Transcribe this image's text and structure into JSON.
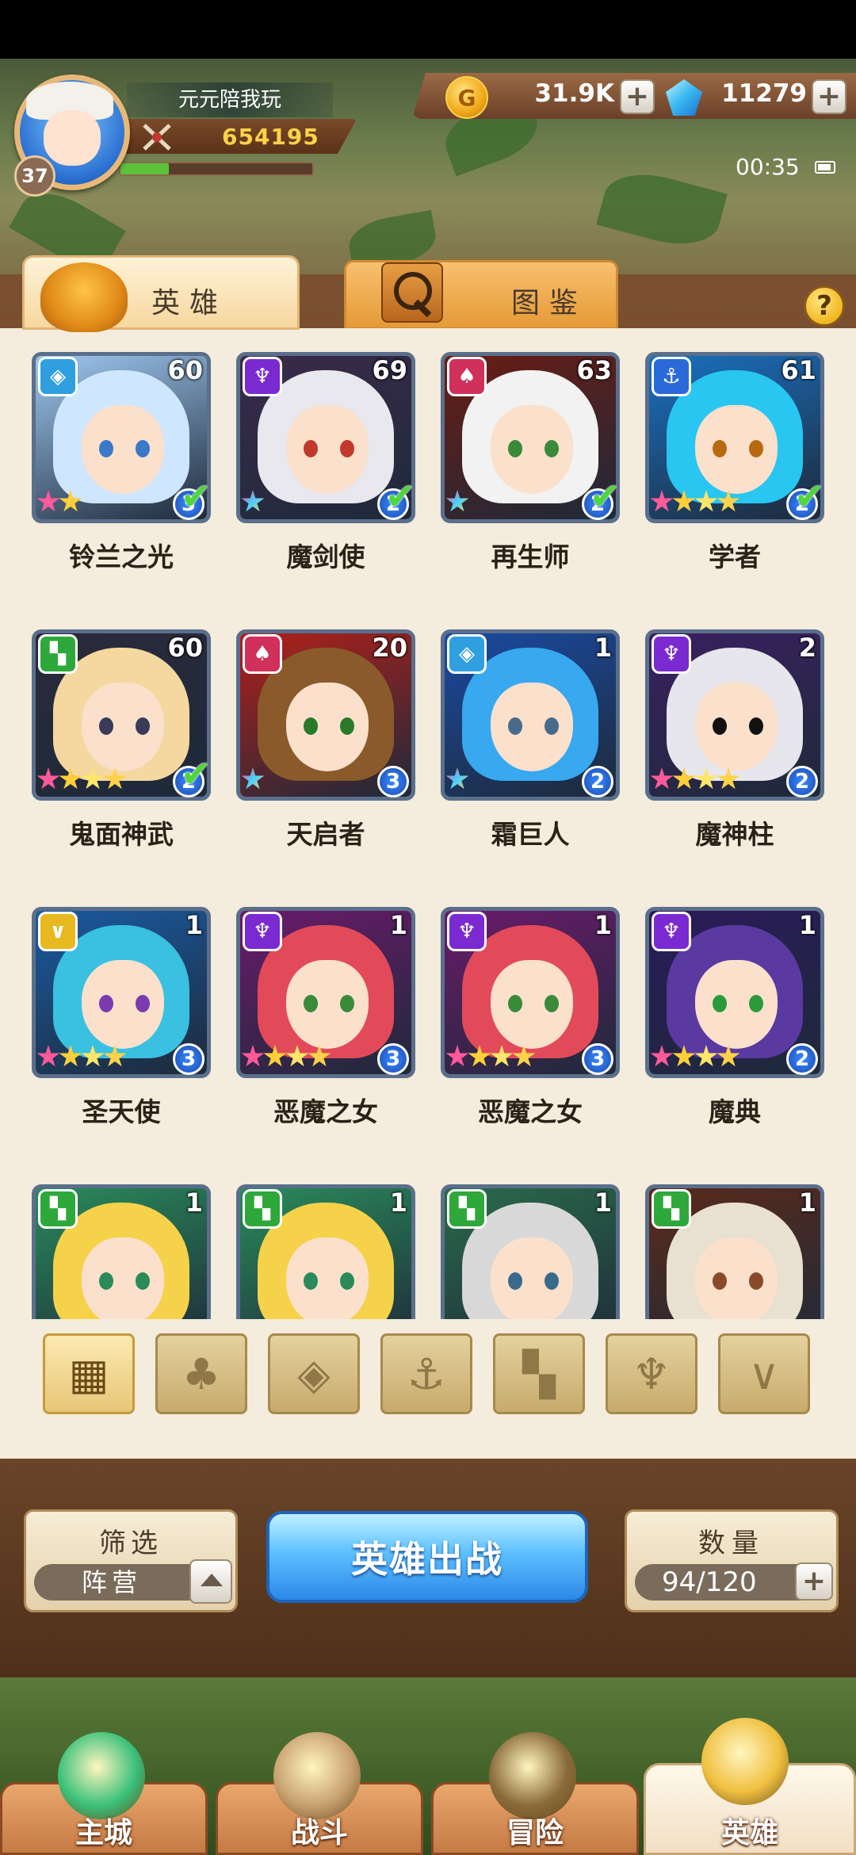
{
  "player": {
    "name": "元元陪我玩",
    "level": "37",
    "power": "654195",
    "xp_fraction": 0.25
  },
  "currency": {
    "gold": "31.9K",
    "gems": "11279",
    "plus_symbol": "+",
    "coin_glyph": "G"
  },
  "status": {
    "time": "00:35"
  },
  "tabs": {
    "heroes": "英雄",
    "codex": "图鉴",
    "help": "?"
  },
  "heroes": [
    {
      "name": "铃兰之光",
      "level": "60",
      "stars": 2,
      "rank": "3",
      "deployed": true,
      "faction": "blue",
      "colors": [
        "#cfe6ff",
        "#9ec8f0",
        "#3a78c8"
      ]
    },
    {
      "name": "魔剑使",
      "level": "69",
      "stars": 1,
      "rank": "2",
      "deployed": true,
      "faction": "purple",
      "colors": [
        "#e8e8ee",
        "#3a2a4a",
        "#c0392b"
      ]
    },
    {
      "name": "再生师",
      "level": "63",
      "stars": 1,
      "rank": "2",
      "deployed": true,
      "faction": "red",
      "colors": [
        "#f2f2f2",
        "#6a1c14",
        "#3a8a3a"
      ]
    },
    {
      "name": "学者",
      "level": "61",
      "stars": 4,
      "rank": "2",
      "deployed": true,
      "faction": "anchor",
      "colors": [
        "#28c6f0",
        "#1a70c0",
        "#b86a10"
      ]
    },
    {
      "name": "鬼面神武",
      "level": "60",
      "stars": 4,
      "rank": "2",
      "deployed": true,
      "faction": "green",
      "colors": [
        "#f4d8a0",
        "#2a2a3a",
        "#3a3a5a"
      ]
    },
    {
      "name": "天启者",
      "level": "20",
      "stars": 1,
      "rank": "3",
      "deployed": false,
      "faction": "red",
      "colors": [
        "#8a5a2a",
        "#b0201a",
        "#2a7a2a"
      ]
    },
    {
      "name": "霜巨人",
      "level": "1",
      "stars": 1,
      "rank": "2",
      "deployed": false,
      "faction": "blue",
      "colors": [
        "#38a8f0",
        "#1a4aa0",
        "#4a6a8a"
      ]
    },
    {
      "name": "魔神柱",
      "level": "2",
      "stars": 4,
      "rank": "2",
      "deployed": false,
      "faction": "purple",
      "colors": [
        "#e6e6ec",
        "#3a2060",
        "#111111"
      ]
    },
    {
      "name": "圣天使",
      "level": "1",
      "stars": 4,
      "rank": "3",
      "deployed": false,
      "faction": "yellow",
      "colors": [
        "#3ac0e0",
        "#1a5aa0",
        "#7a3ab0"
      ]
    },
    {
      "name": "恶魔之女",
      "level": "1",
      "stars": 4,
      "rank": "3",
      "deployed": false,
      "faction": "purple",
      "colors": [
        "#e24a5a",
        "#6a1a6a",
        "#3a8a3a"
      ]
    },
    {
      "name": "恶魔之女",
      "level": "1",
      "stars": 4,
      "rank": "3",
      "deployed": false,
      "faction": "purple",
      "colors": [
        "#e24a5a",
        "#6a1a6a",
        "#3a8a3a"
      ]
    },
    {
      "name": "魔典",
      "level": "1",
      "stars": 4,
      "rank": "2",
      "deployed": false,
      "faction": "purple",
      "colors": [
        "#5a3aa0",
        "#2a1a5a",
        "#2a9a3a"
      ]
    },
    {
      "name": "",
      "level": "1",
      "stars": 0,
      "rank": "",
      "deployed": false,
      "faction": "green",
      "colors": [
        "#f6d24a",
        "#2a8a5a",
        "#2a8a5a"
      ]
    },
    {
      "name": "",
      "level": "1",
      "stars": 0,
      "rank": "",
      "deployed": false,
      "faction": "green",
      "colors": [
        "#f6d24a",
        "#2a8a5a",
        "#2a8a5a"
      ]
    },
    {
      "name": "",
      "level": "1",
      "stars": 0,
      "rank": "",
      "deployed": false,
      "faction": "green",
      "colors": [
        "#d8d8d8",
        "#2a6a4a",
        "#3a6a8a"
      ]
    },
    {
      "name": "",
      "level": "1",
      "stars": 0,
      "rank": "",
      "deployed": false,
      "faction": "green",
      "colors": [
        "#e8e0d0",
        "#5a2a1a",
        "#8a4a2a"
      ]
    }
  ],
  "faction_colors": {
    "blue": "#2f9fe0",
    "purple": "#7a2ad0",
    "red": "#d0305a",
    "anchor": "#2a6ad8",
    "green": "#2ea83a",
    "yellow": "#e8b820"
  },
  "faction_filters": [
    {
      "name": "all",
      "glyph": "▦",
      "active": true
    },
    {
      "name": "nature",
      "glyph": "♣",
      "active": false
    },
    {
      "name": "crystal",
      "glyph": "◈",
      "active": false
    },
    {
      "name": "anchor",
      "glyph": "⚓",
      "active": false
    },
    {
      "name": "beast",
      "glyph": "▚",
      "active": false
    },
    {
      "name": "demon",
      "glyph": "♆",
      "active": false
    },
    {
      "name": "wing",
      "glyph": "∨",
      "active": false
    }
  ],
  "controls": {
    "filter_title": "筛选",
    "filter_value": "阵营",
    "deploy_label": "英雄出战",
    "count_title": "数量",
    "count_value": "94/120"
  },
  "nav": [
    {
      "label": "主城",
      "active": false
    },
    {
      "label": "战斗",
      "active": false
    },
    {
      "label": "冒险",
      "active": false
    },
    {
      "label": "英雄",
      "active": true
    }
  ]
}
